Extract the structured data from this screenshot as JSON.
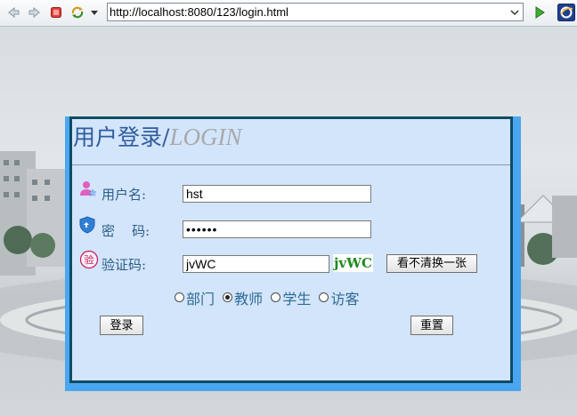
{
  "browser": {
    "url": "http://localhost:8080/123/login.html",
    "icons": [
      "back-icon",
      "forward-icon",
      "stop-icon",
      "refresh-icon",
      "dropdown-icon",
      "go-icon",
      "ie-logo-icon"
    ]
  },
  "login": {
    "title_cn": "用户登录",
    "title_sep": "/",
    "title_en": "LOGIN",
    "username_label": "用户名:",
    "username_value": "hst",
    "password_label": "密    码:",
    "password_value": "123456",
    "captcha_label": "验证码:",
    "captcha_value": "jvWC",
    "captcha_image_text": "jvWC",
    "refresh_captcha_label": "看不清换一张",
    "roles": [
      {
        "label": "部门",
        "checked": false
      },
      {
        "label": "教师",
        "checked": true
      },
      {
        "label": "学生",
        "checked": false
      },
      {
        "label": "访客",
        "checked": false
      }
    ],
    "login_button": "登录",
    "reset_button": "重置"
  },
  "colors": {
    "panel_bg": "#d3e5fa",
    "panel_border": "#0e4b66",
    "panel_frame": "#4aa6f0",
    "title_blue": "#2f5b9e",
    "title_gray": "#a6a9ad",
    "label_blue": "#2d5d88",
    "captcha_green": "#1f8a1f"
  }
}
